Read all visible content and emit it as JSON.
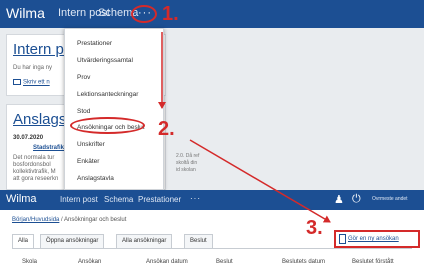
{
  "top_screenshot": {
    "app_title": "Wilma",
    "nav": [
      "Intern post",
      "Schema"
    ],
    "more_button": "···",
    "step_labels": [
      "1.",
      "2."
    ],
    "card1": {
      "title": "Intern po",
      "line": "Du har inga ny",
      "link": "Skriv ett n"
    },
    "card2": {
      "title": "Anslagst",
      "date": "30.07.2020",
      "link": "Stadstrafik",
      "lines": [
        "Det normala tur",
        "bosfordonsbol",
        "kollektivtrafik, M",
        "att gora reseerkn"
      ]
    },
    "right_text": [
      "2.0. Då ref",
      "skoltå din",
      "id skolan"
    ],
    "menu_items": [
      "Prestationer",
      "Utvärderingssamtal",
      "Prov",
      "Lektionsanteckningar",
      "Stod",
      "Ansökningar och beslut",
      "Unskrifter",
      "Enkäter",
      "Anslagstavla"
    ]
  },
  "bottom_screenshot": {
    "app_title": "Wilma",
    "nav": [
      "Intern post",
      "Schema",
      "Prestationer"
    ],
    "more_button": "···",
    "user_name": "Ovrmeste andet",
    "breadcrumb_link": "Början/Huvudsida",
    "breadcrumb_rest": " / Ansökningar och beslut",
    "tabs": [
      "Alla",
      "Öppna ansökningar",
      "Alla ansökningar",
      "Beslut"
    ],
    "new_application_link": "Gör en ny ansökan",
    "step_label": "3.",
    "columns": [
      "Skola",
      "Ansökan",
      "Ansökan datum",
      "Beslut",
      "Beslutets datum",
      "Beslutet förstått"
    ]
  },
  "colors": {
    "navbar": "#1c4f93",
    "annotation_red": "#d42a2a",
    "link_blue": "#1c4f93"
  },
  "icons": [
    "ellipsis-icon",
    "envelope-icon",
    "user-switch-icon",
    "power-icon",
    "document-icon",
    "arrow-icon"
  ]
}
